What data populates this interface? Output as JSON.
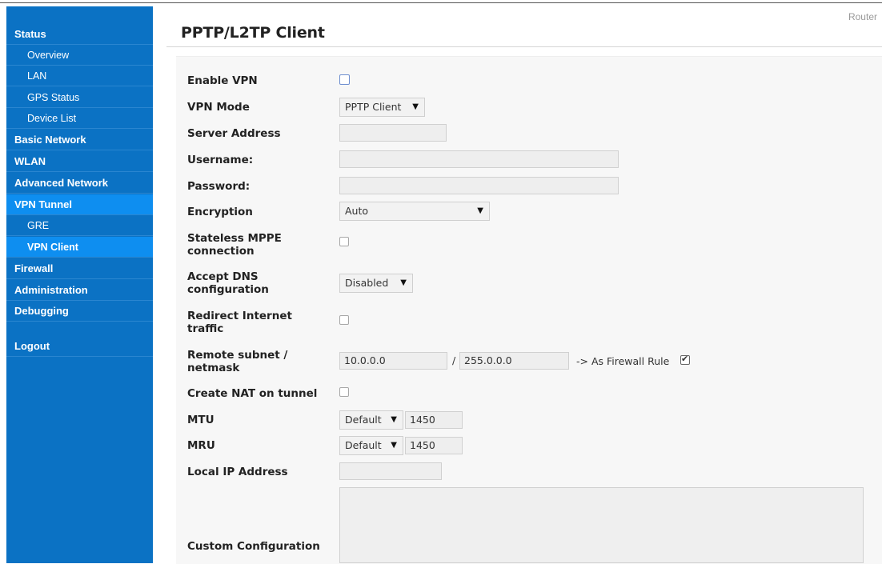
{
  "brand": "Router",
  "page_title": "PPTP/L2TP Client",
  "sidebar": {
    "items": [
      {
        "label": "Status"
      },
      {
        "label": "Overview"
      },
      {
        "label": "LAN"
      },
      {
        "label": "GPS Status"
      },
      {
        "label": "Device List"
      },
      {
        "label": "Basic Network"
      },
      {
        "label": "WLAN"
      },
      {
        "label": "Advanced Network"
      },
      {
        "label": "VPN Tunnel"
      },
      {
        "label": "GRE"
      },
      {
        "label": "VPN Client"
      },
      {
        "label": "Firewall"
      },
      {
        "label": "Administration"
      },
      {
        "label": "Debugging"
      },
      {
        "label": "Logout"
      }
    ]
  },
  "form": {
    "enable_vpn": {
      "label": "Enable VPN",
      "checked": false
    },
    "vpn_mode": {
      "label": "VPN Mode",
      "value": "PPTP Client"
    },
    "server_address": {
      "label": "Server Address",
      "value": ""
    },
    "username": {
      "label": "Username:",
      "value": ""
    },
    "password": {
      "label": "Password:",
      "value": ""
    },
    "encryption": {
      "label": "Encryption",
      "value": "Auto"
    },
    "stateless_mppe": {
      "label_line1": "Stateless MPPE",
      "label_line2": "connection",
      "checked": false
    },
    "accept_dns": {
      "label_line1": "Accept DNS",
      "label_line2": "configuration",
      "value": "Disabled"
    },
    "redirect_internet": {
      "label_line1": "Redirect Internet",
      "label_line2": "traffic",
      "checked": false
    },
    "remote_subnet": {
      "label_line1": "Remote subnet /",
      "label_line2": "netmask",
      "subnet": "10.0.0.0",
      "separator": "/",
      "netmask": "255.0.0.0",
      "firewall_rule_text": "-> As Firewall Rule",
      "firewall_rule_checked": true
    },
    "create_nat": {
      "label": "Create NAT on tunnel",
      "checked": false
    },
    "mtu": {
      "label": "MTU",
      "mode": "Default",
      "value": "1450"
    },
    "mru": {
      "label": "MRU",
      "mode": "Default",
      "value": "1450"
    },
    "local_ip": {
      "label": "Local IP Address",
      "value": ""
    },
    "custom_config": {
      "label": "Custom Configuration",
      "value": ""
    }
  },
  "icons": {
    "dropdown": "chevron-down-icon",
    "checkbox": "checkbox-icon"
  },
  "colors": {
    "sidebar_bg": "#0b72c4",
    "sidebar_active": "#0e8ef0",
    "panel_bg": "#f7f7f7"
  }
}
